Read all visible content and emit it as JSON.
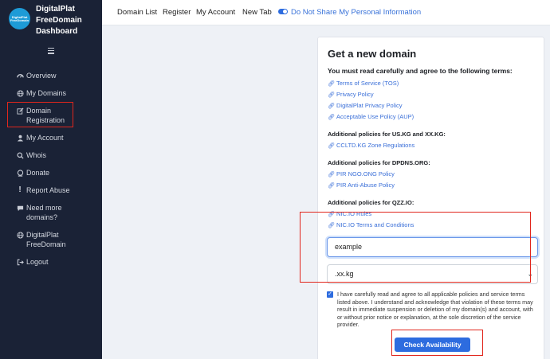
{
  "brand": {
    "logo_text": "DigitalPlat FreeDomain",
    "title": "DigitalPlat FreeDomain Dashboard"
  },
  "sidebar": {
    "items": [
      {
        "label": "Overview",
        "icon": "gauge-icon"
      },
      {
        "label": "My Domains",
        "icon": "globe-icon"
      },
      {
        "label": "Domain Registration",
        "icon": "edit-icon"
      },
      {
        "label": "My Account",
        "icon": "user-icon"
      },
      {
        "label": "Whois",
        "icon": "search-icon"
      },
      {
        "label": "Donate",
        "icon": "donate-icon"
      },
      {
        "label": "Report Abuse",
        "icon": "exclamation-icon"
      },
      {
        "label": "Need more domains?",
        "icon": "chat-icon"
      },
      {
        "label": "DigitalPlat FreeDomain",
        "icon": "globe-icon"
      },
      {
        "label": "Logout",
        "icon": "logout-icon"
      }
    ]
  },
  "topbar": {
    "links": [
      "Domain List",
      "Register",
      "My Account",
      "New Tab"
    ],
    "privacy": "Do Not Share My Personal Information"
  },
  "card": {
    "title": "Get a new domain",
    "intro": "You must read carefully and agree to the following terms:",
    "terms": [
      "Terms of Service (TOS)",
      "Privacy Policy",
      "DigitalPlat Privacy Policy",
      "Acceptable Use Policy (AUP)"
    ],
    "sections": [
      {
        "heading": "Additional policies for US.KG and XX.KG:",
        "links": [
          "CCLTD.KG Zone Regulations"
        ]
      },
      {
        "heading": "Additional policies for DPDNS.ORG:",
        "links": [
          "PIR NGO.ONG Policy",
          "PIR Anti-Abuse Policy"
        ]
      },
      {
        "heading": "Additional policies for QZZ.IO:",
        "links": [
          "NIC.IO Rules",
          "NIC.IO Terms and Conditions"
        ]
      }
    ],
    "domain_input_value": "example",
    "suffix_selected": ".xx.kg",
    "agree_text": "I have carefully read and agree to all applicable policies and service terms listed above. I understand and acknowledge that violation of these terms may result in immediate suspension or deletion of my domain(s) and account, with or without prior notice or explanation, at the sole discretion of the service provider.",
    "button_label": "Check Availability"
  },
  "colors": {
    "sidebar_bg": "#1a2236",
    "accent": "#2d6cdf",
    "highlight": "#e1261c",
    "link": "#3a6fd8"
  }
}
